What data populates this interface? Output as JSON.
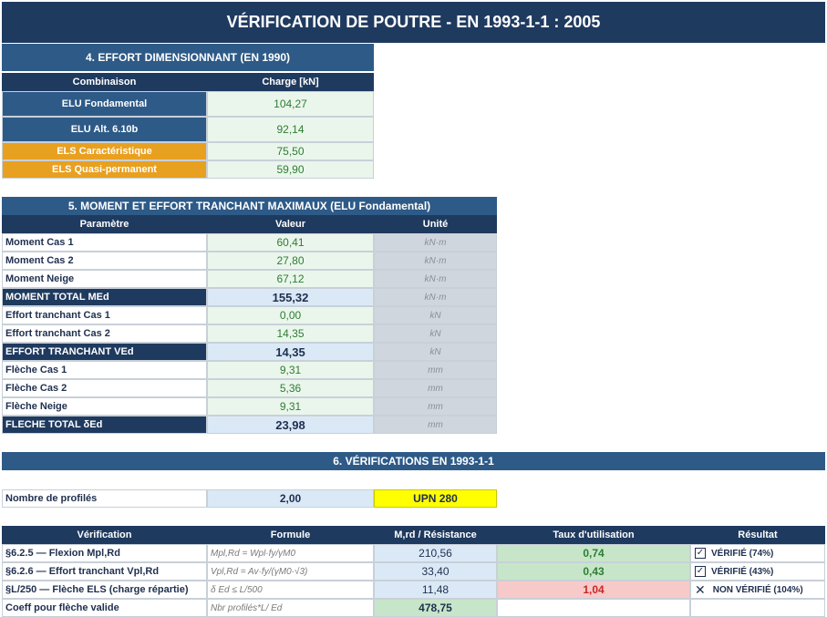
{
  "title": "VÉRIFICATION DE POUTRE - EN 1993-1-1 : 2005",
  "section4": {
    "title": "4. EFFORT DIMENSIONNANT (EN 1990)",
    "col_combinaison": "Combinaison",
    "col_charge": "Charge  [kN]",
    "rows": [
      {
        "label": "ELU Fondamental",
        "value": "104,27",
        "kind": "blue"
      },
      {
        "label": "ELU Alt. 6.10b",
        "value": "92,14",
        "kind": "blue"
      },
      {
        "label": "ELS Caractéristique",
        "value": "75,50",
        "kind": "orange"
      },
      {
        "label": "ELS Quasi-permanent",
        "value": "59,90",
        "kind": "orange"
      }
    ]
  },
  "section5": {
    "title": "5. MOMENT ET EFFORT TRANCHANT MAXIMAUX (ELU Fondamental)",
    "col_param": "Paramètre",
    "col_valeur": "Valeur",
    "col_unite": "Unité",
    "rows": [
      {
        "label": "Moment Cas 1",
        "value": "60,41",
        "unit": "kN·m",
        "total": false
      },
      {
        "label": "Moment Cas 2",
        "value": "27,80",
        "unit": "kN·m",
        "total": false
      },
      {
        "label": "Moment Neige",
        "value": "67,12",
        "unit": "kN·m",
        "total": false
      },
      {
        "label": "MOMENT TOTAL MEd",
        "value": "155,32",
        "unit": "kN·m",
        "total": true
      },
      {
        "label": "Effort tranchant Cas 1",
        "value": "0,00",
        "unit": "kN",
        "total": false
      },
      {
        "label": "Effort tranchant Cas 2",
        "value": "14,35",
        "unit": "kN",
        "total": false
      },
      {
        "label": "EFFORT TRANCHANT VEd",
        "value": "14,35",
        "unit": "kN",
        "total": true
      },
      {
        "label": "Flèche Cas 1",
        "value": "9,31",
        "unit": "mm",
        "total": false
      },
      {
        "label": "Flèche Cas 2",
        "value": "5,36",
        "unit": "mm",
        "total": false
      },
      {
        "label": "Flèche Neige",
        "value": "9,31",
        "unit": "mm",
        "total": false
      },
      {
        "label": "FLECHE TOTAL δEd",
        "value": "23,98",
        "unit": "mm",
        "total": true
      }
    ]
  },
  "section6": {
    "title": "6. VÉRIFICATIONS EN 1993-1-1",
    "nb_label": "Nombre de profilés",
    "nb_value": "2,00",
    "profile": "UPN 280",
    "col_verif": "Vérification",
    "col_formule": "Formule",
    "col_mrd": "M,rd / Résistance",
    "col_taux": "Taux d'utilisation",
    "col_resultat": "Résultat",
    "rows": [
      {
        "label": "§6.2.5 — Flexion Mpl,Rd",
        "formula": "Mpl,Rd = Wpl·fy/γM0",
        "mrd": "210,56",
        "taux": "0,74",
        "ok": true,
        "result": "VÉRIFIÉ  (74%)",
        "icon": "checkbox-checked-icon"
      },
      {
        "label": "§6.2.6 — Effort tranchant Vpl,Rd",
        "formula": "Vpl,Rd = Av·fy/(γM0·√3)",
        "mrd": "33,40",
        "taux": "0,43",
        "ok": true,
        "result": "VÉRIFIÉ  (43%)",
        "icon": "checkbox-checked-icon"
      },
      {
        "label": "§L/250 — Flèche ELS (charge répartie)",
        "formula": "δ Ed ≤ L/500",
        "mrd": "11,48",
        "taux": "1,04",
        "ok": false,
        "result": "NON VÉRIFIÉ  (104%)",
        "icon": "cross-icon"
      }
    ],
    "coeff_label": "Coeff pour flèche valide",
    "coeff_formula": "Nbr profilés*L/ Ed",
    "coeff_value": "478,75"
  },
  "colors": {
    "dark_navy": "#1f3a5f",
    "section_blue": "#2e5a87",
    "orange": "#e8a020",
    "green_text": "#2e7d32",
    "red_text": "#c62828",
    "highlight_yellow": "#ffff00"
  }
}
